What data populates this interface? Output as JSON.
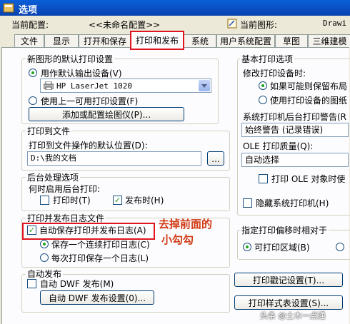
{
  "window": {
    "title": "选项"
  },
  "header": {
    "current_profile_label": "当前配置:",
    "current_profile_value": "<<未命名配置>>",
    "current_drawing_label": "当前图形:",
    "current_drawing_value": "Drawi"
  },
  "tabs": [
    {
      "label": "文件"
    },
    {
      "label": "显示"
    },
    {
      "label": "打开和保存"
    },
    {
      "label": "打印和发布",
      "active": true
    },
    {
      "label": "系统"
    },
    {
      "label": "用户系统配置"
    },
    {
      "label": "草图"
    },
    {
      "label": "三维建模"
    }
  ],
  "new_drawing": {
    "title": "新图形的默认打印设置",
    "use_default_device": "用作默认输出设备(V)",
    "device_value": "HP LaserJet 1020",
    "use_last_device": "使用上一可用打印设置(F)",
    "add_plotter_button": "添加或配置绘图仪(P)..."
  },
  "plot_to_file": {
    "title": "打印到文件",
    "location_label": "打印到文件操作的默认位置(D):",
    "location_value": "D:\\我的文档",
    "browse_button": "..."
  },
  "background": {
    "title": "后台处理选项",
    "when_label": "何时启用后台打印:",
    "plotting": "打印时(T)",
    "publishing": "发布时(H)"
  },
  "log": {
    "title": "打印并发布日志文件",
    "auto_save": "自动保存打印并发布日志(A)",
    "continuous": "保存一个连续打印日志(C)",
    "per_plot": "每次打印保存一个日志(L)"
  },
  "auto_publish": {
    "title": "自动发布",
    "auto_dwf": "自动 DWF 发布(M)",
    "dwf_settings_button": "自动 DWF 发布设置(0)..."
  },
  "general": {
    "title": "基本打印选项",
    "change_device_label": "修改打印设备时:",
    "keep_layout": "如果可能则保留布局",
    "use_paper": "使用打印设备的图纸",
    "spool_alert_label": "系统打印机后台打印警告(R",
    "spool_alert_value": "始终警告 (记录错误)",
    "ole_quality_label": "OLE 打印质量(Q):",
    "ole_quality_value": "自动选择",
    "use_ole": "打印 OLE 对象时使",
    "hide_printers": "隐藏系统打印机(H)"
  },
  "offset": {
    "title": "指定打印偏移时相对于",
    "printable_area": "可打印区域(B)"
  },
  "buttons": {
    "plot_stamp": "打印戳记设置(T)...",
    "plot_style": "打印样式表设置(S)..."
  },
  "annotation": {
    "line1": "去掉前面的",
    "line2": "小勾勾"
  },
  "watermark": {
    "text": "头条 @土木一点通"
  },
  "colors": {
    "annotation": "#D03A14",
    "highlight": "#E0141E",
    "title_bar": "#0A5FD8",
    "check_green": "#21A121"
  }
}
